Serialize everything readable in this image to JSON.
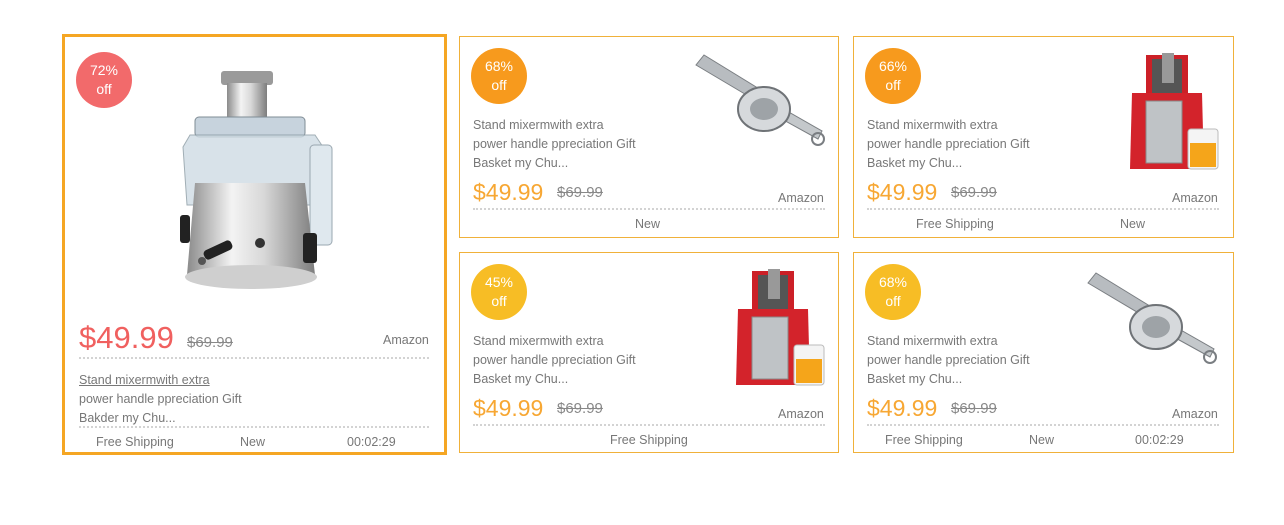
{
  "colors": {
    "card_border": "#f0b13a",
    "selected_border": "#f5a623",
    "price_orange": "#f7a733",
    "price_red": "#f0605f",
    "badge_red": "#f26a6b",
    "badge_orange": "#f79a1d",
    "badge_yellow": "#f7bd25"
  },
  "cards": [
    {
      "badge": {
        "pct": "72%",
        "off": "off",
        "color": "#f26a6b"
      },
      "image": "juicer-silver-image",
      "price": "$49.99",
      "old_price": "$69.99",
      "store": "Amazon",
      "desc": [
        "Stand mixermwith extra",
        "power handle ppreciation Gift",
        "Bakder my Chu..."
      ],
      "shipping": "Free Shipping",
      "condition": "New",
      "timer": "00:02:29"
    },
    {
      "badge": {
        "pct": "68%",
        "off": "off",
        "color": "#f79a1d"
      },
      "image": "lemon-squeezer-image",
      "desc": [
        "Stand mixermwith extra",
        "power handle ppreciation Gift",
        "Basket my Chu..."
      ],
      "price": "$49.99",
      "old_price": "$69.99",
      "store": "Amazon",
      "condition": "New"
    },
    {
      "badge": {
        "pct": "66%",
        "off": "off",
        "color": "#f79a1d"
      },
      "image": "juicer-red-image",
      "desc": [
        "Stand mixermwith extra",
        "power handle ppreciation Gift",
        "Basket my Chu..."
      ],
      "price": "$49.99",
      "old_price": "$69.99",
      "store": "Amazon",
      "shipping": "Free Shipping",
      "condition": "New"
    },
    {
      "badge": {
        "pct": "45%",
        "off": "off",
        "color": "#f7bd25"
      },
      "image": "juicer-red-image",
      "desc": [
        "Stand mixermwith extra",
        "power handle ppreciation Gift",
        "Basket my Chu..."
      ],
      "price": "$49.99",
      "old_price": "$69.99",
      "store": "Amazon",
      "shipping": "Free Shipping"
    },
    {
      "badge": {
        "pct": "68%",
        "off": "off",
        "color": "#f7bd25"
      },
      "image": "lemon-squeezer-image",
      "desc": [
        "Stand mixermwith extra",
        "power handle ppreciation Gift",
        "Basket my Chu..."
      ],
      "price": "$49.99",
      "old_price": "$69.99",
      "store": "Amazon",
      "shipping": "Free Shipping",
      "condition": "New",
      "timer": "00:02:29"
    }
  ]
}
